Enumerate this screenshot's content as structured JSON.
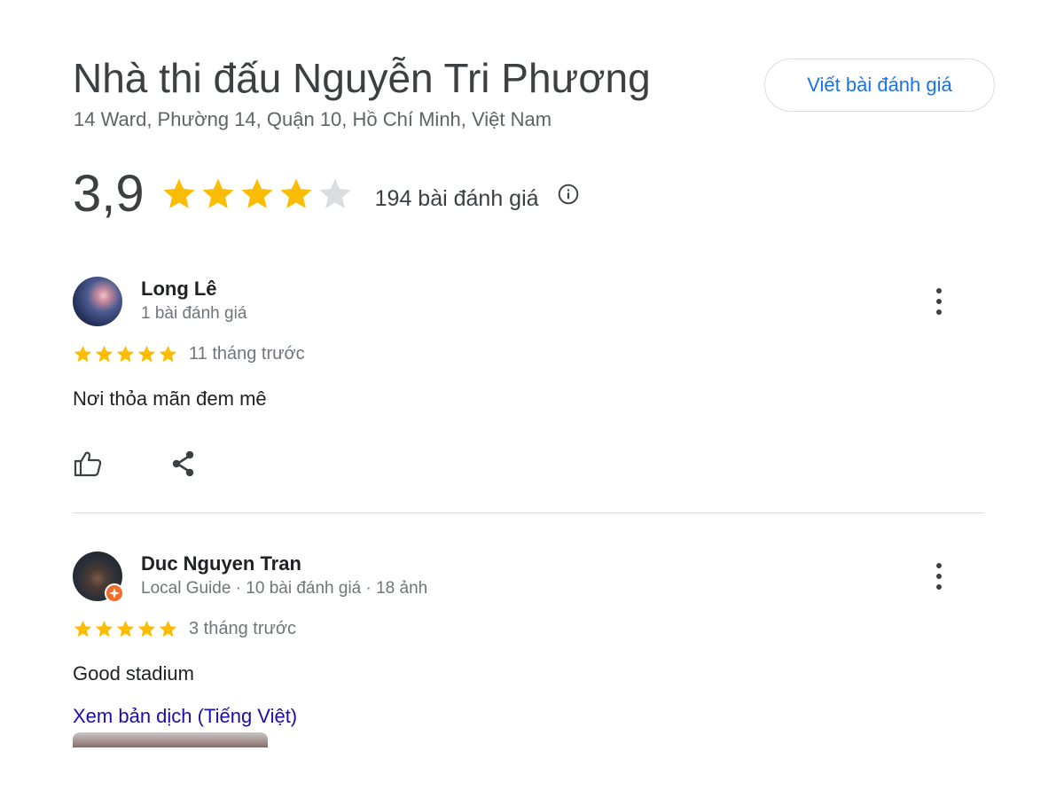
{
  "place": {
    "title": "Nhà thi đấu Nguyễn Tri Phương",
    "address": "14 Ward, Phường 14, Quận 10, Hồ Chí Minh, Việt Nam"
  },
  "write_review": {
    "label": "Viết bài đánh giá"
  },
  "rating": {
    "value": "3,9",
    "stars": 3.9,
    "count_label": "194 bài đánh giá",
    "info_icon": "info-icon"
  },
  "colors": {
    "star_filled": "#fbbc04",
    "star_empty": "#dadce0",
    "link": "#1a0dab",
    "accent": "#1a73e8",
    "local_guide_badge": "#ef6c2a"
  },
  "reviews": [
    {
      "name": "Long Lê",
      "meta": "1 bài đánh giá",
      "stars": 5,
      "time": "11 tháng trước",
      "text": "Nơi thỏa mãn đem mê",
      "icons": [
        "more-vert-icon",
        "thumb-up-icon",
        "share-icon"
      ]
    },
    {
      "name": "Duc Nguyen Tran",
      "meta": "Local Guide · 10 bài đánh giá · 18 ảnh",
      "stars": 5,
      "time": "3 tháng trước",
      "text": "Good stadium",
      "translate_link": "Xem bản dịch (Tiếng Việt)",
      "icons": [
        "more-vert-icon",
        "local-guide-badge-icon"
      ]
    }
  ]
}
